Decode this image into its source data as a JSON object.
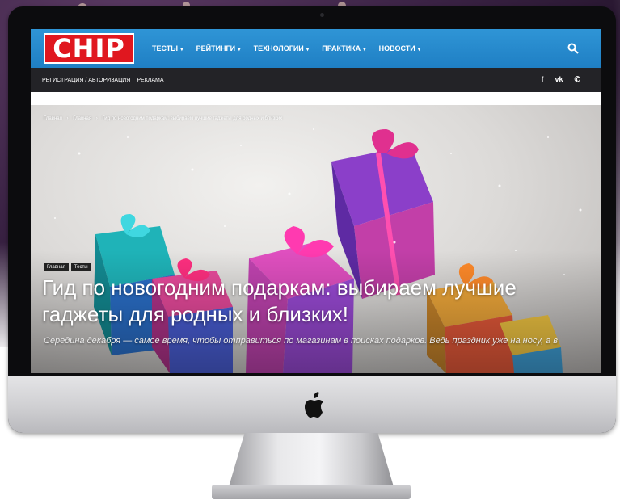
{
  "site": {
    "logo_text": "CHIP",
    "brand_color": "#e0171f",
    "header_color": "#2a8bcf"
  },
  "nav": {
    "items": [
      {
        "label": "ТЕСТЫ",
        "icon": "chevron-down-icon"
      },
      {
        "label": "РЕЙТИНГИ",
        "icon": "chevron-down-icon"
      },
      {
        "label": "ТЕХНОЛОГИИ",
        "icon": "chevron-down-icon"
      },
      {
        "label": "ПРАКТИКА",
        "icon": "chevron-down-icon"
      },
      {
        "label": "НОВОСТИ",
        "icon": "chevron-down-icon"
      }
    ],
    "search_icon": "search-icon"
  },
  "subbar": {
    "links": [
      "РЕГИСТРАЦИЯ / АВТОРИЗАЦИЯ",
      "РЕКЛАМА"
    ],
    "socials": [
      {
        "label": "f",
        "icon": "facebook-icon"
      },
      {
        "label": "vk",
        "icon": "vk-icon"
      },
      {
        "label": "✆",
        "icon": "viber-icon"
      }
    ]
  },
  "article": {
    "breadcrumb": [
      "Главная",
      "›",
      "Главная",
      "›",
      "Гид по новогодним подаркам: выбираем лучшие гаджеты для родных и близких"
    ],
    "tags": [
      "Главная",
      "Тесты"
    ],
    "title": "Гид по новогодним подаркам: выбираем лучшие гаджеты для родных и близких!",
    "excerpt": "Середина декабря — самое время, чтобы отправиться по магазинам в поисках подарков. Ведь праздник уже на носу, а в"
  }
}
